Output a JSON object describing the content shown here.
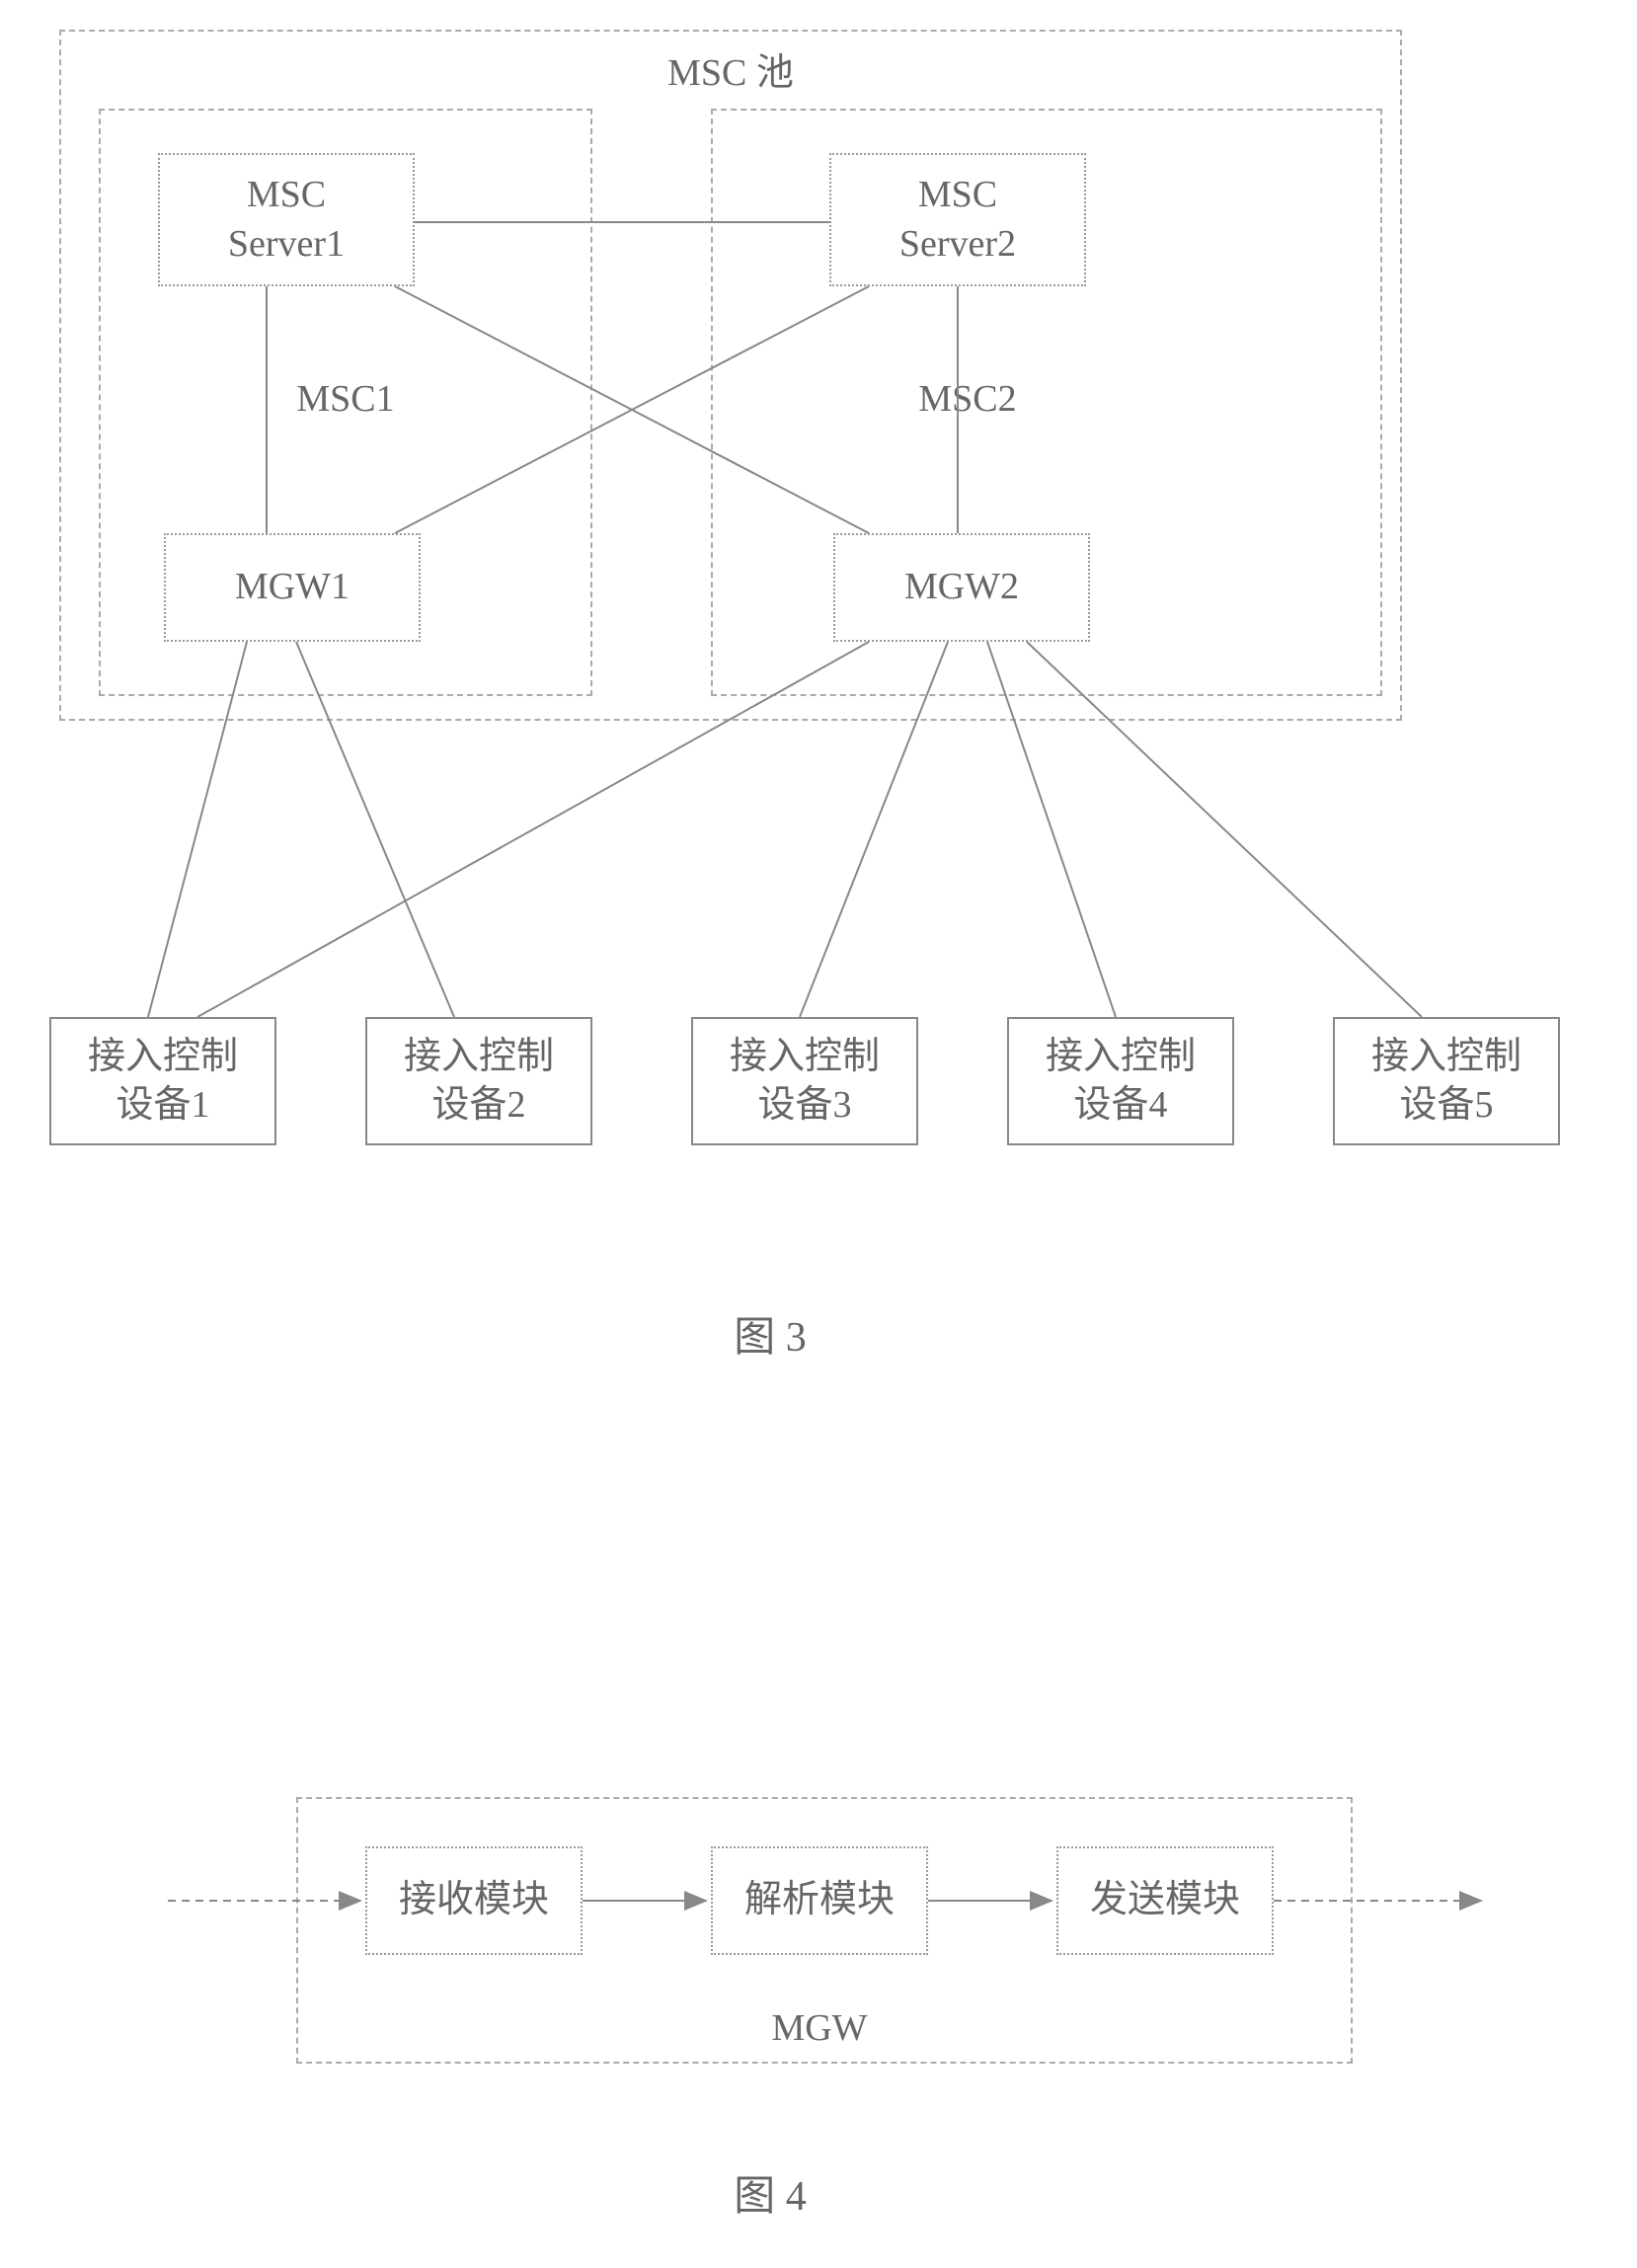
{
  "fig3": {
    "title": "MSC 池",
    "msc1": "MSC1",
    "msc2": "MSC2",
    "server1_line1": "MSC",
    "server1_line2": "Server1",
    "server2_line1": "MSC",
    "server2_line2": "Server2",
    "mgw1": "MGW1",
    "mgw2": "MGW2",
    "dev1_line1": "接入控制",
    "dev1_line2": "设备1",
    "dev2_line1": "接入控制",
    "dev2_line2": "设备2",
    "dev3_line1": "接入控制",
    "dev3_line2": "设备3",
    "dev4_line1": "接入控制",
    "dev4_line2": "设备4",
    "dev5_line1": "接入控制",
    "dev5_line2": "设备5",
    "caption": "图  3"
  },
  "fig4": {
    "container_label": "MGW",
    "mod1": "接收模块",
    "mod2": "解析模块",
    "mod3": "发送模块",
    "caption": "图  4"
  }
}
